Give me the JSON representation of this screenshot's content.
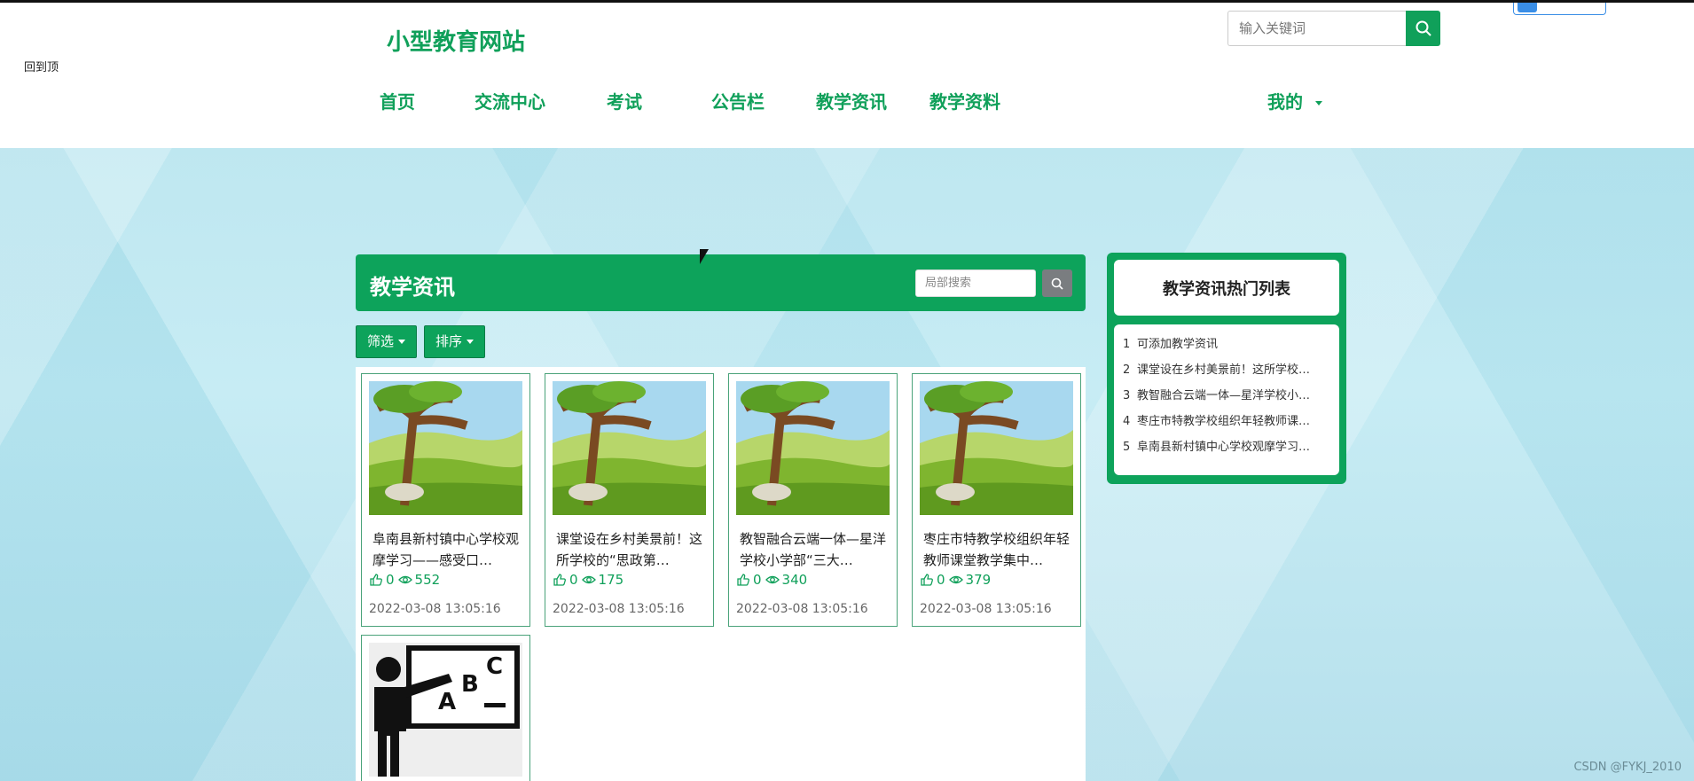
{
  "header": {
    "side_label": "回到顶",
    "site_title": "小型教育网站",
    "search_placeholder": "输入关键词",
    "nav": [
      {
        "label": "首页"
      },
      {
        "label": "交流中心"
      },
      {
        "label": "考试"
      },
      {
        "label": "公告栏"
      },
      {
        "label": "教学资讯"
      },
      {
        "label": "教学资料"
      }
    ],
    "account_label": "我的"
  },
  "section": {
    "title": "教学资讯",
    "local_search_placeholder": "局部搜索",
    "filter_label": "筛选",
    "sort_label": "排序"
  },
  "cards": [
    {
      "title": "阜南县新村镇中心学校观摩学习——感受口…",
      "likes": "0",
      "views": "552",
      "date": "2022-03-08 13:05:16"
    },
    {
      "title": "课堂设在乡村美景前！这所学校的“思政第…",
      "likes": "0",
      "views": "175",
      "date": "2022-03-08 13:05:16"
    },
    {
      "title": "教智融合云端一体—星洋学校小学部“三大…",
      "likes": "0",
      "views": "340",
      "date": "2022-03-08 13:05:16"
    },
    {
      "title": "枣庄市特教学校组织年轻教师课堂教学集中…",
      "likes": "0",
      "views": "379",
      "date": "2022-03-08 13:05:16"
    }
  ],
  "hot": {
    "title": "教学资讯热门列表",
    "items": [
      {
        "num": "1",
        "text": "可添加教学资讯"
      },
      {
        "num": "2",
        "text": "课堂设在乡村美景前！这所学校…"
      },
      {
        "num": "3",
        "text": "教智融合云端一体—星洋学校小…"
      },
      {
        "num": "4",
        "text": "枣庄市特教学校组织年轻教师课…"
      },
      {
        "num": "5",
        "text": "阜南县新村镇中心学校观摩学习…"
      }
    ]
  },
  "watermark": "CSDN @FYKJ_2010",
  "colors": {
    "brand": "#0da35b",
    "text_green": "#10a05a"
  }
}
